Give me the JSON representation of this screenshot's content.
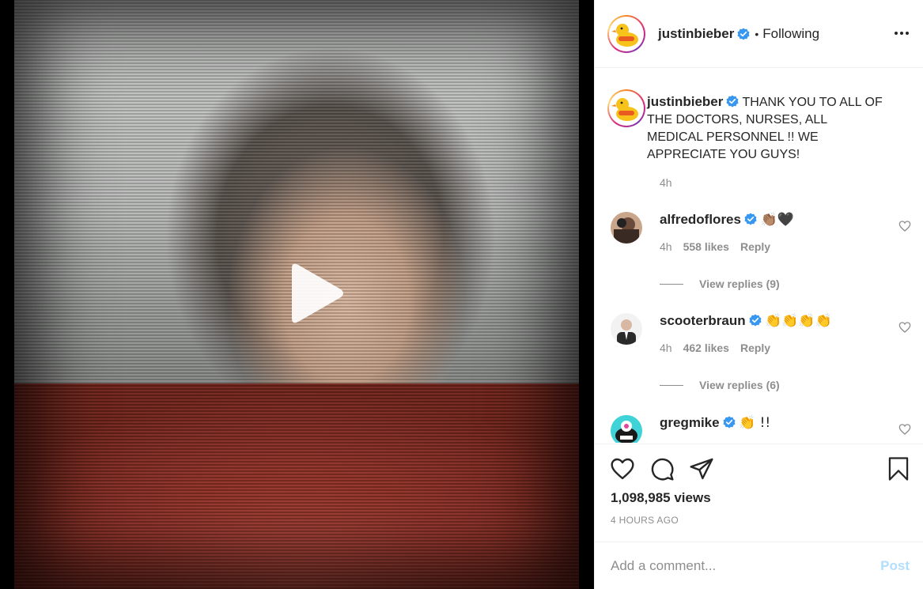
{
  "post": {
    "author": "justinbieber",
    "separator": "•",
    "follow_status": "Following",
    "caption": "THANK YOU TO ALL OF THE DOCTORS, NURSES, ALL MEDICAL PERSONNEL !! WE APPRECIATE YOU GUYS!",
    "caption_time": "4h",
    "views": "1,098,985 views",
    "posted_ago": "4 HOURS AGO"
  },
  "comments": [
    {
      "username": "alfredoflores",
      "text": "👏🏽🖤",
      "time": "4h",
      "likes": "558 likes",
      "reply": "Reply",
      "view_replies": "View replies (9)"
    },
    {
      "username": "scooterbraun",
      "text": "👏👏👏👏",
      "time": "4h",
      "likes": "462 likes",
      "reply": "Reply",
      "view_replies": "View replies (6)"
    },
    {
      "username": "gregmike",
      "text": "👏 !!"
    }
  ],
  "comment_box": {
    "placeholder": "Add a comment...",
    "post_label": "Post"
  },
  "icons": {
    "verified": "verified-badge-icon",
    "more": "more-options-icon",
    "play": "play-icon",
    "like": "heart-icon",
    "comment": "comment-icon",
    "share": "share-icon",
    "save": "bookmark-icon"
  },
  "colors": {
    "verified_blue": "#3897f0",
    "muted": "#8e8e8e",
    "post_disabled": "#b2dffc",
    "text": "#262626"
  }
}
